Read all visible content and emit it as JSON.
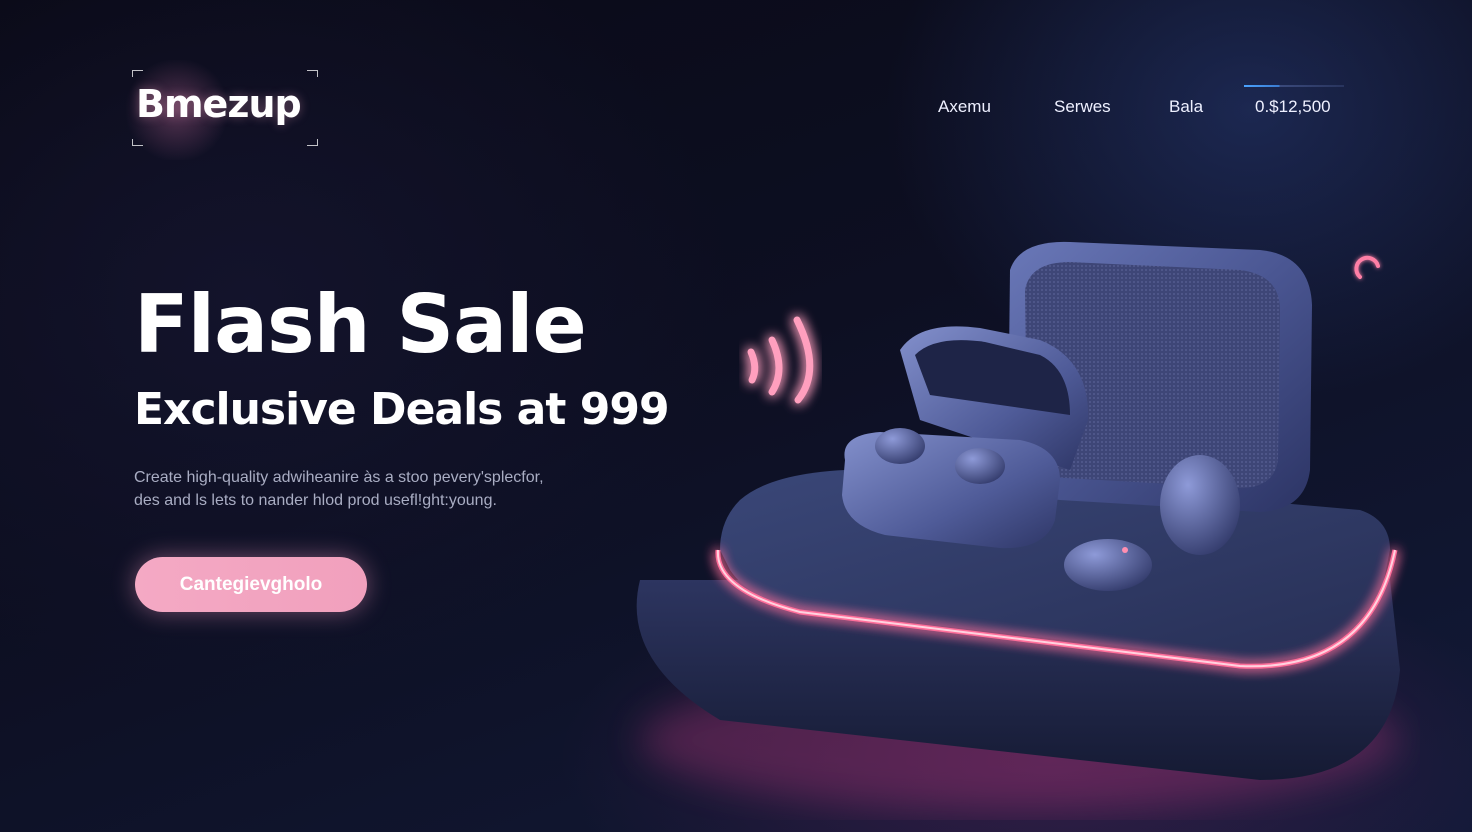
{
  "brand": {
    "name": "Bmezup"
  },
  "nav": {
    "items": [
      {
        "label": "Axemu"
      },
      {
        "label": "Serwes"
      },
      {
        "label": "Bala"
      },
      {
        "label": "0.$12,500"
      }
    ]
  },
  "hero": {
    "title": "Flash Sale",
    "subtitle": "Exclusive Deals at 999",
    "description_lines": [
      "Create high-quality adwiheanire às a stoo pevery'splecfor,",
      "des and ls lets to nander hlod prod usefl!ght:young."
    ],
    "cta_label": "Cantegievgholo"
  },
  "colors": {
    "accent_pink": "#f4a9c4",
    "neon_pink": "#ff5f8f",
    "nav_highlight": "#4aa3ff",
    "background": "#0b0c1a"
  },
  "icons": {
    "wave": "sound-wave-icon",
    "loader": "loading-ring-icon"
  }
}
